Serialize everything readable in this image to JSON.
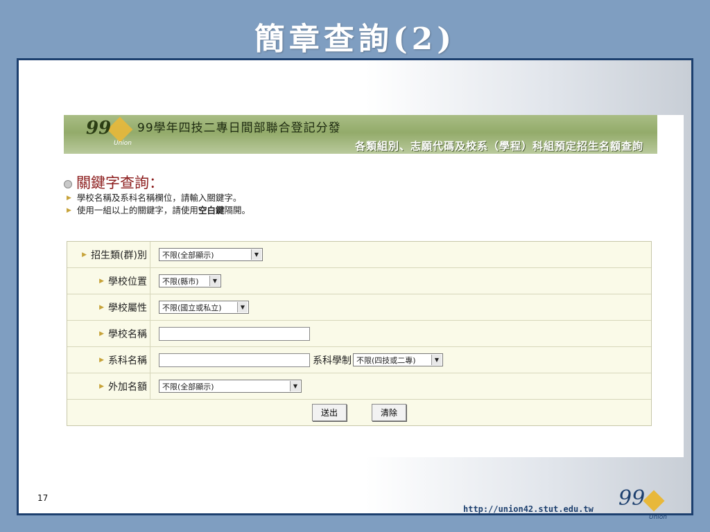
{
  "slide": {
    "title": "簡章查詢(2)",
    "number": "17",
    "footer_url": "http://union42.stut.edu.tw",
    "footer_logo_text": "99",
    "footer_logo_sub": "Union"
  },
  "banner": {
    "logo_text": "99",
    "logo_sub": "Union",
    "title": "99學年四技二專日間部聯合登記分發",
    "subtitle": "各類組別、志願代碼及校系（學程）科組預定招生名額查詢"
  },
  "search": {
    "section_title": "關鍵字查詢：",
    "note1": "學校名稱及系科名稱欄位，請輸入關鍵字。",
    "note2_pre": "使用一組以上的關鍵字，請使用",
    "note2_bold": "空白鍵",
    "note2_post": "隔開。"
  },
  "form": {
    "category_label": "招生類(群)別",
    "category_value": "不限(全部顯示)",
    "location_label": "學校位置",
    "location_value": "不限(縣市)",
    "attribute_label": "學校屬性",
    "attribute_value": "不限(國立或私立)",
    "school_name_label": "學校名稱",
    "school_name_value": "",
    "dept_name_label": "系科名稱",
    "dept_name_value": "",
    "system_label": "系科學制",
    "system_value": "不限(四技或二專)",
    "extra_quota_label": "外加名額",
    "extra_quota_value": "不限(全部顯示)",
    "submit_label": "送出",
    "clear_label": "清除"
  },
  "colors": {
    "slide_bg": "#7f9ec1",
    "frame_border": "#1c3f6e",
    "section_title": "#8b1b1b",
    "form_bg": "#fafae8"
  }
}
